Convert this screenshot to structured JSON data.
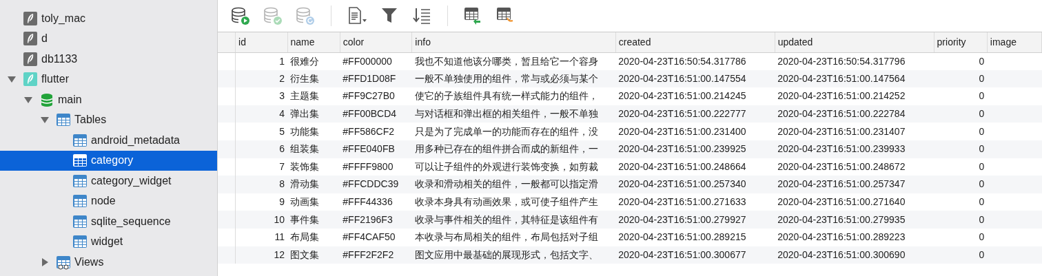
{
  "sidebar": {
    "items": [
      {
        "label": "toly_mac",
        "kind": "connection",
        "connected": false,
        "selected": false
      },
      {
        "label": "d",
        "kind": "connection",
        "connected": false,
        "selected": false
      },
      {
        "label": "db1133",
        "kind": "connection",
        "connected": false,
        "selected": false
      },
      {
        "label": "flutter",
        "kind": "connection",
        "connected": true,
        "selected": false,
        "expanded": true,
        "children": [
          {
            "label": "main",
            "kind": "database",
            "selected": false,
            "expanded": true,
            "children": [
              {
                "label": "Tables",
                "kind": "tables",
                "selected": false,
                "expanded": true,
                "children": [
                  {
                    "label": "android_metadata",
                    "kind": "table",
                    "selected": false
                  },
                  {
                    "label": "category",
                    "kind": "table",
                    "selected": true
                  },
                  {
                    "label": "category_widget",
                    "kind": "table",
                    "selected": false
                  },
                  {
                    "label": "node",
                    "kind": "table",
                    "selected": false
                  },
                  {
                    "label": "sqlite_sequence",
                    "kind": "table",
                    "selected": false
                  },
                  {
                    "label": "widget",
                    "kind": "table",
                    "selected": false
                  }
                ]
              },
              {
                "label": "Views",
                "kind": "views",
                "selected": false,
                "expanded": false
              }
            ]
          }
        ]
      }
    ]
  },
  "toolbar": [
    {
      "kind": "run",
      "disabled": false
    },
    {
      "kind": "commit",
      "disabled": true
    },
    {
      "kind": "rollback",
      "disabled": true
    },
    {
      "kind": "separator"
    },
    {
      "kind": "document-menu",
      "disabled": false
    },
    {
      "kind": "filter",
      "disabled": false
    },
    {
      "kind": "sort",
      "disabled": false
    },
    {
      "kind": "separator"
    },
    {
      "kind": "table-import",
      "disabled": false
    },
    {
      "kind": "table-export",
      "disabled": false
    }
  ],
  "table": {
    "columns": [
      "id",
      "name",
      "color",
      "info",
      "created",
      "updated",
      "priority",
      "image"
    ],
    "rows": [
      [
        "1",
        "很难分",
        "#FF000000",
        "我也不知道他该分哪类，暂且给它一个容身",
        "2020-04-23T16:50:54.317786",
        "2020-04-23T16:50:54.317796",
        "0"
      ],
      [
        "2",
        "衍生集",
        "#FFD1D08F",
        "一般不单独使用的组件，常与或必须与某个",
        "2020-04-23T16:51:00.147554",
        "2020-04-23T16:51:00.147564",
        "0"
      ],
      [
        "3",
        "主题集",
        "#FF9C27B0",
        "使它的子族组件具有统一样式能力的组件，",
        "2020-04-23T16:51:00.214245",
        "2020-04-23T16:51:00.214252",
        "0"
      ],
      [
        "4",
        "弹出集",
        "#FF00BCD4",
        "与对话框和弹出框的相关组件，一般不单独",
        "2020-04-23T16:51:00.222777",
        "2020-04-23T16:51:00.222784",
        "0"
      ],
      [
        "5",
        "功能集",
        "#FF586CF2",
        "只是为了完成单一的功能而存在的组件，没",
        "2020-04-23T16:51:00.231400",
        "2020-04-23T16:51:00.231407",
        "0"
      ],
      [
        "6",
        "组装集",
        "#FFE040FB",
        "用多种已存在的组件拼合而成的新组件，一",
        "2020-04-23T16:51:00.239925",
        "2020-04-23T16:51:00.239933",
        "0"
      ],
      [
        "7",
        "装饰集",
        "#FFFF9800",
        "可以让子组件的外观进行装饰变换，如剪裁",
        "2020-04-23T16:51:00.248664",
        "2020-04-23T16:51:00.248672",
        "0"
      ],
      [
        "8",
        "滑动集",
        "#FFCDDC39",
        "收录和滑动相关的组件，一般都可以指定滑",
        "2020-04-23T16:51:00.257340",
        "2020-04-23T16:51:00.257347",
        "0"
      ],
      [
        "9",
        "动画集",
        "#FFF44336",
        "收录本身具有动画效果，或可使子组件产生",
        "2020-04-23T16:51:00.271633",
        "2020-04-23T16:51:00.271640",
        "0"
      ],
      [
        "10",
        "事件集",
        "#FF2196F3",
        "收录与事件相关的组件，其特征是该组件有",
        "2020-04-23T16:51:00.279927",
        "2020-04-23T16:51:00.279935",
        "0"
      ],
      [
        "11",
        "布局集",
        "#FF4CAF50",
        "本收录与布局相关的组件，布局包括对子组",
        "2020-04-23T16:51:00.289215",
        "2020-04-23T16:51:00.289223",
        "0"
      ],
      [
        "12",
        "图文集",
        "#FFF2F2F2",
        "图文应用中最基础的展现形式，包括文字、",
        "2020-04-23T16:51:00.300677",
        "2020-04-23T16:51:00.300690",
        "0"
      ]
    ]
  }
}
